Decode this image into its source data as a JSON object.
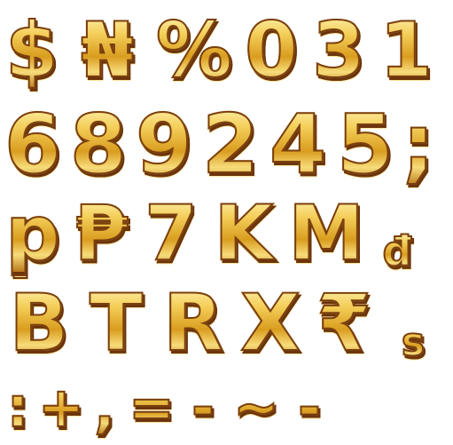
{
  "glyph_sheet": {
    "rows": [
      [
        "$",
        "₦",
        "%",
        "0",
        "3",
        "1"
      ],
      [
        "6",
        "8",
        "9",
        "2",
        "4",
        "5",
        ";"
      ],
      [
        "p",
        "₱",
        "7",
        "K",
        "M",
        "đ"
      ],
      [
        "B",
        "T",
        "R",
        "X",
        "₹",
        "s"
      ],
      [
        ":",
        "+",
        ",",
        "=",
        "-",
        "~",
        "-"
      ]
    ],
    "colors": {
      "gold_light": "#fff3b3",
      "gold_mid": "#e7b53a",
      "gold_dark": "#b9791a",
      "outline_brown": "#7a3f0e",
      "background": "#ffffff"
    }
  }
}
